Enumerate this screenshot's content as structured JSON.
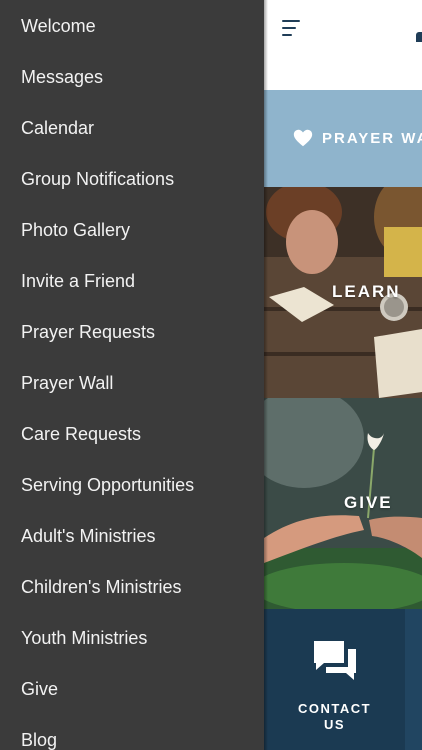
{
  "drawer": {
    "items": [
      {
        "label": "Welcome"
      },
      {
        "label": "Messages"
      },
      {
        "label": "Calendar"
      },
      {
        "label": "Group Notifications"
      },
      {
        "label": "Photo Gallery"
      },
      {
        "label": "Invite a Friend"
      },
      {
        "label": "Prayer Requests"
      },
      {
        "label": "Prayer Wall"
      },
      {
        "label": "Care Requests"
      },
      {
        "label": "Serving Opportunities"
      },
      {
        "label": "Adult's Ministries"
      },
      {
        "label": "Children's Ministries"
      },
      {
        "label": "Youth Ministries"
      },
      {
        "label": "Give"
      },
      {
        "label": "Blog"
      }
    ]
  },
  "main": {
    "prayer_tile": {
      "label": "PRAYER WA"
    },
    "learn_tile": {
      "label": "LEARN"
    },
    "give_tile": {
      "label": "GIVE"
    },
    "contact_tile": {
      "line1": "CONTACT",
      "line2": "US"
    }
  },
  "colors": {
    "drawer_bg": "#3b3b3b",
    "navy": "#1b3a52",
    "prayer_blue": "#8fb4cc"
  }
}
